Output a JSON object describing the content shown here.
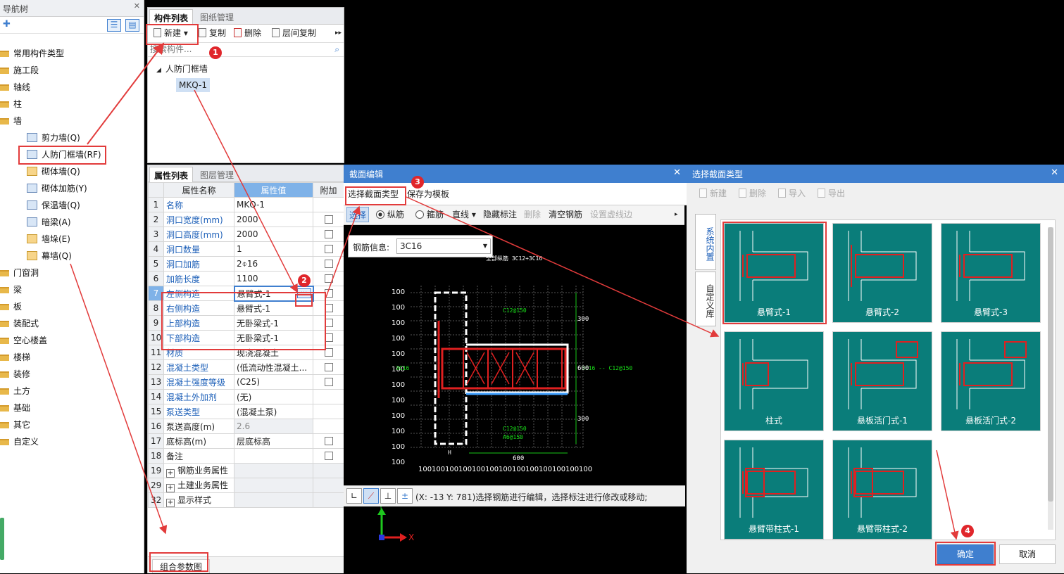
{
  "nav": {
    "title": "导航树",
    "items": [
      {
        "label": "常用构件类型",
        "type": "folder"
      },
      {
        "label": "施工段",
        "type": "folder"
      },
      {
        "label": "轴线",
        "type": "folder"
      },
      {
        "label": "柱",
        "type": "folder"
      },
      {
        "label": "墙",
        "type": "folder"
      },
      {
        "label": "剪力墙(Q)",
        "type": "child"
      },
      {
        "label": "人防门框墙(RF)",
        "type": "child"
      },
      {
        "label": "砌体墙(Q)",
        "type": "child"
      },
      {
        "label": "砌体加筋(Y)",
        "type": "child"
      },
      {
        "label": "保温墙(Q)",
        "type": "child"
      },
      {
        "label": "暗梁(A)",
        "type": "child"
      },
      {
        "label": "墙垛(E)",
        "type": "child"
      },
      {
        "label": "幕墙(Q)",
        "type": "child"
      },
      {
        "label": "门窗洞",
        "type": "folder"
      },
      {
        "label": "梁",
        "type": "folder"
      },
      {
        "label": "板",
        "type": "folder"
      },
      {
        "label": "装配式",
        "type": "folder"
      },
      {
        "label": "空心楼盖",
        "type": "folder"
      },
      {
        "label": "楼梯",
        "type": "folder"
      },
      {
        "label": "装修",
        "type": "folder"
      },
      {
        "label": "土方",
        "type": "folder"
      },
      {
        "label": "基础",
        "type": "folder"
      },
      {
        "label": "其它",
        "type": "folder"
      },
      {
        "label": "自定义",
        "type": "folder"
      }
    ]
  },
  "comp": {
    "tabs": [
      "构件列表",
      "图纸管理"
    ],
    "toolbar": {
      "new": "新建",
      "copy": "复制",
      "delete": "删除",
      "floor_copy": "层间复制"
    },
    "search_placeholder": "搜索构件...",
    "tree_parent": "人防门框墙",
    "tree_child": "MKQ-1"
  },
  "props": {
    "tabs": [
      "属性列表",
      "图层管理"
    ],
    "headers": [
      "属性名称",
      "属性值",
      "附加"
    ],
    "rows": [
      {
        "n": "1",
        "k": "名称",
        "v": "MKQ-1",
        "blue": true,
        "chk": false
      },
      {
        "n": "2",
        "k": "洞口宽度(mm)",
        "v": "2000",
        "blue": true,
        "chk": true
      },
      {
        "n": "3",
        "k": "洞口高度(mm)",
        "v": "2000",
        "blue": true,
        "chk": true
      },
      {
        "n": "4",
        "k": "洞口数量",
        "v": "1",
        "blue": true,
        "chk": true
      },
      {
        "n": "5",
        "k": "洞口加筋",
        "v": "2⌽16",
        "blue": true,
        "chk": true
      },
      {
        "n": "6",
        "k": "加筋长度",
        "v": "1100",
        "blue": true,
        "chk": true
      },
      {
        "n": "7",
        "k": "左侧构造",
        "v": "悬臂式-1",
        "blue": true,
        "chk": true
      },
      {
        "n": "8",
        "k": "右侧构造",
        "v": "悬臂式-1",
        "blue": true,
        "chk": true
      },
      {
        "n": "9",
        "k": "上部构造",
        "v": "无卧梁式-1",
        "blue": true,
        "chk": true
      },
      {
        "n": "10",
        "k": "下部构造",
        "v": "无卧梁式-1",
        "blue": true,
        "chk": true
      },
      {
        "n": "11",
        "k": "材质",
        "v": "现浇混凝土",
        "blue": true,
        "chk": true
      },
      {
        "n": "12",
        "k": "混凝土类型",
        "v": "(低流动性混凝土...",
        "blue": true,
        "chk": true
      },
      {
        "n": "13",
        "k": "混凝土强度等级",
        "v": "(C25)",
        "blue": true,
        "chk": true
      },
      {
        "n": "14",
        "k": "混凝土外加剂",
        "v": "(无)",
        "blue": true,
        "chk": false
      },
      {
        "n": "15",
        "k": "泵送类型",
        "v": "(混凝土泵)",
        "blue": true,
        "chk": false
      },
      {
        "n": "16",
        "k": "泵送高度(m)",
        "v": "2.6",
        "blue": false,
        "chk": false,
        "gray": true
      },
      {
        "n": "17",
        "k": "底标高(m)",
        "v": "层底标高",
        "blue": false,
        "chk": true
      },
      {
        "n": "18",
        "k": "备注",
        "v": "",
        "blue": false,
        "chk": true
      },
      {
        "n": "19",
        "k": "钢筋业务属性",
        "v": "",
        "blue": false,
        "chk": false,
        "group": true
      },
      {
        "n": "29",
        "k": "土建业务属性",
        "v": "",
        "blue": false,
        "chk": false,
        "group": true
      },
      {
        "n": "32",
        "k": "显示样式",
        "v": "",
        "blue": false,
        "chk": false,
        "group": true
      }
    ],
    "bottom_button": "组合参数图"
  },
  "sec": {
    "title": "截面编辑",
    "tabs": [
      "选择截面类型",
      "保存为模板"
    ],
    "toolbar": {
      "select": "选择",
      "long": "纵筋",
      "stir": "箍筋",
      "line": "直线",
      "hide": "隐藏标注",
      "del": "删除",
      "clear": "清空钢筋",
      "dash": "设置虚线边"
    },
    "rebar_label": "钢筋信息:",
    "rebar_value": "3C16",
    "status": "(X: -13 Y: 781)选择钢筋进行编辑，选择标注进行修改或移动;",
    "cad": {
      "top_note": "全部纵筋 3C12+3C16",
      "c1": "C12@150",
      "c2": "C12@150",
      "c3": "A6@150",
      "side": "3C16 -- C12@150",
      "left": "3C16",
      "d300a": "300",
      "d300b": "300",
      "d600": "600",
      "d600b": "600",
      "h": "H",
      "grid_left": [
        "100",
        "100",
        "100",
        "100",
        "100",
        "100",
        "100",
        "100",
        "100",
        "100",
        "100",
        "100"
      ],
      "grid_bottom": [
        "100",
        "100",
        "100",
        "100",
        "100",
        "100",
        "100",
        "100",
        "100",
        "100",
        "100",
        "100",
        "100"
      ]
    }
  },
  "sel": {
    "title": "选择截面类型",
    "toolbar": {
      "new": "新建",
      "del": "删除",
      "imp": "导入",
      "exp": "导出"
    },
    "side_tabs": [
      "系统内置",
      "自定义库"
    ],
    "cards": [
      "悬臂式-1",
      "悬臂式-2",
      "悬臂式-3",
      "柱式",
      "悬板活门式-1",
      "悬板活门式-2",
      "悬臂带柱式-1",
      "悬臂带柱式-2"
    ],
    "ok": "确定",
    "cancel": "取消"
  },
  "badges": [
    "1",
    "2",
    "3",
    "4"
  ],
  "colors": {
    "accent": "#3f7fcf",
    "annotation": "#e23b3b",
    "card": "#0a7d7a"
  }
}
